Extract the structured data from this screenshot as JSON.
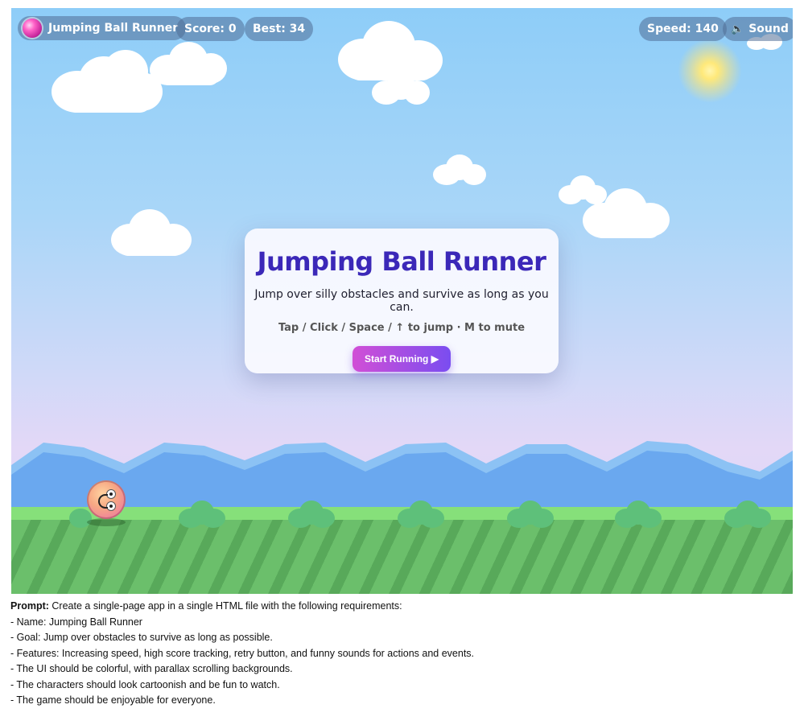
{
  "hud": {
    "title": "Jumping Ball Runner",
    "score": "Score: 0",
    "best": "Best: 34",
    "speed": "Speed: 140",
    "sound": "Sound",
    "sound_icon": "speaker-icon"
  },
  "card": {
    "title": "Jumping Ball Runner",
    "description": "Jump over silly obstacles and survive as long as you can.",
    "controls": "Tap / Click / Space / ↑ to jump · M to mute",
    "start_button": "Start Running ▶"
  },
  "colors": {
    "sky_top": "#8ecdf8",
    "title_color": "#3b28b8",
    "button_gradient_start": "#d14fd6",
    "button_gradient_end": "#7a4df0",
    "grass": "#6bbf6b",
    "mountains": "#6aa8ef"
  },
  "prompt": {
    "label": "Prompt:",
    "intro": "Create a single-page app in a single HTML file with the following requirements:",
    "lines": [
      "- Name: Jumping Ball Runner",
      "- Goal: Jump over obstacles to survive as long as possible.",
      "- Features: Increasing speed, high score tracking, retry button, and funny sounds for actions and events.",
      "- The UI should be colorful, with parallax scrolling backgrounds.",
      "- The characters should look cartoonish and be fun to watch.",
      "- The game should be enjoyable for everyone."
    ]
  }
}
